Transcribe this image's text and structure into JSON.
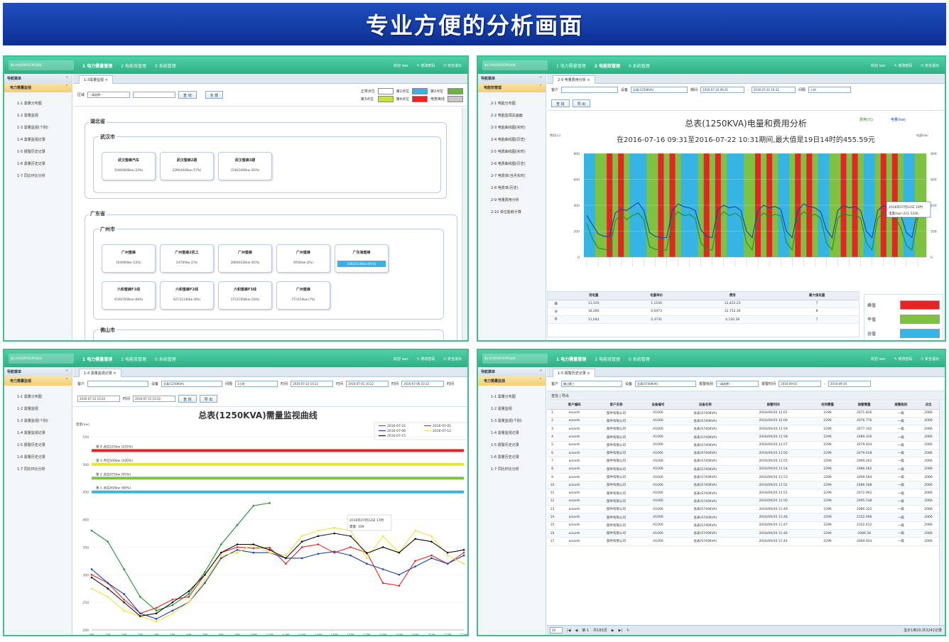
{
  "banner": {
    "title": "专业方便的分析画面"
  },
  "panel1": {
    "logo": "新川中创SKM2EMS系统",
    "menu_tabs": [
      "1 电力需量管理",
      "2 电能效管理",
      "0 系统管理"
    ],
    "user": "欢迎 iser",
    "change_pwd": "修改密码",
    "logout": "安全退出",
    "nav_title": "导航菜单",
    "group": "电力需量监视",
    "items": [
      "1-1 需量分布图",
      "1-2 需量监视",
      "1-3 需量监视(个别)",
      "1-4 需量监视记录",
      "1-5 报警历史记录",
      "1-6 需量历史记录",
      "1-7 同比环比分析"
    ],
    "tab": "1-3需量监视",
    "filter_label": "区域",
    "filter_select": "--请选择--",
    "query": "查 询",
    "all": "全 部",
    "legend": [
      "正常点位",
      "第1点位",
      "第2点位",
      "第3点位",
      "第4点位",
      "电表离线"
    ],
    "province1": "湖北省",
    "city1": "武汉市",
    "cards1": [
      {
        "n": "武汉蜜蜂汽车",
        "v": "1546/6600kw (24%)"
      },
      {
        "n": "武汉蜜蜂2期",
        "v": "2296/4000kw (57%)"
      },
      {
        "n": "武汉蜜蜂3期",
        "v": "1546/2400kw (65%)"
      }
    ],
    "province2": "广东省",
    "city2": "广州市",
    "cards2": [
      {
        "n": "广州蜜蜂",
        "v": "104/900kw (12%)"
      },
      {
        "n": "广州蜜蜂2机工",
        "v": "10/700kw (1%)"
      },
      {
        "n": "广州蜜蜂",
        "v": "2809/4320kw (65%)"
      },
      {
        "n": "广州蜜蜂",
        "v": "9/500kw (2%)"
      },
      {
        "n": "广东海蜜蜂",
        "v": "1042/1140kw (91%)"
      },
      {
        "n": "六和蜜蜂F1线",
        "v": "4740/7000kw (68%)"
      },
      {
        "n": "六和蜜蜂F2线",
        "v": "927/11140kw (8%)"
      },
      {
        "n": "六和蜜蜂F3线",
        "v": "1713/7000kw (24%)"
      },
      {
        "n": "广州蜜蜂",
        "v": "77/1150kw (7%)"
      }
    ],
    "city3": "佛山市"
  },
  "panel2": {
    "logo": "新川中创SKM2EMS系统",
    "menu_tabs": [
      "1 电力需量管理",
      "2 电能效管理",
      "0 系统管理"
    ],
    "user": "欢迎 iser",
    "change_pwd": "修改密码",
    "logout": "安全退出",
    "nav_title": "导航菜单",
    "group": "电能效管理",
    "items": [
      "2-1 电能分布图",
      "2-2 电能监视总画面",
      "2-3 电能曲线图(实时)",
      "2-4 电能曲线图(历史)",
      "2-5 电费曲线图(实时)",
      "2-6 电费曲线图(历史)",
      "2-7 电费单(当月实时)",
      "2-8 电费单(历史)",
      "2-9 电量费用分析",
      "2-10 单位能耗计算"
    ],
    "tab": "2-9 电量费用分析",
    "f_customer": "客户",
    "f_device": "设备",
    "f_device_val": "总表(1250KVA)",
    "f_period": "期间",
    "f_from": "2016-07-16 09:31",
    "f_to": "2016-07-22 10:31",
    "f_interval": "间隔",
    "f_interval_val": "小时",
    "query": "查 找",
    "export": "导 出",
    "chart_title": "总表(1250KVA)电量和费用分析",
    "subtitle": "在2016-07-16 09:31至2016-07-22 10:31期间,最大值是19日14时的455.59元",
    "legend_cost": "费用(元)",
    "legend_kwh": "电量(kw)",
    "yl_left": "费用(元)",
    "yl_right": "电量(kw)",
    "tooltip": [
      "2016年07月22日 10时",
      "电量(kw):221.5336"
    ],
    "table_headers": [
      "",
      "用电量",
      "电量单价",
      "费用",
      "最大值电量"
    ],
    "table_rows": [
      [
        "峰",
        "11,103",
        "1.1100",
        "12,422.23",
        "7"
      ],
      [
        "谷",
        "18,280",
        "0.6973",
        "12,752.36",
        "8"
      ],
      [
        "平",
        "11,044",
        "0.3731",
        "4,120.36",
        "7"
      ]
    ],
    "legend_rows": [
      "峰值",
      "平值",
      "谷值"
    ]
  },
  "panel3": {
    "logo": "新川中创SKM2EMS系统",
    "menu_tabs": [
      "1 电力需量管理",
      "2 电能效管理",
      "0 系统管理"
    ],
    "user": "欢迎 iser",
    "change_pwd": "修改密码",
    "logout": "安全退出",
    "nav_title": "导航菜单",
    "group": "电力需量监视",
    "items": [
      "1-1 需量分布图",
      "1-2 需量监视",
      "1-3 需量监视(个别)",
      "1-4 需量监视记录",
      "1-5 报警历史记录",
      "1-6 需量历史记录",
      "1-7 同比环比分析"
    ],
    "tab": "1-4 需量监视记录",
    "f_customer": "客户",
    "f_device": "设备",
    "f_device_val": "总表(1250KVA)",
    "f_interval": "间隔",
    "f_interval_val": "1小时",
    "f_time": "时间",
    "f_t1": "2016-07-22 10:22",
    "f_t2": "2016-07-01 10:22",
    "f_t3": "2016-07-06 10:22",
    "f_t4": "2016-07-12 10:22",
    "f_t5": "2016-07-15 10:22",
    "query": "查 找",
    "export": "导 出",
    "chart_title": "总表(1250KVA)需量监视曲线",
    "ylabel": "需量(kw)",
    "series_names": [
      "2016-07-22",
      "2016-07-01",
      "2016-07-06",
      "2016-07-12",
      "2016-07-15"
    ],
    "limits": [
      "第 4 点位525kw (105%)",
      "第 3 点位500kw (100%)",
      "第 2 点位475kw (95%)",
      "第 1 点位450kw (90%)"
    ],
    "tooltip": [
      "2016年07月12日 17时",
      "需量: 339"
    ]
  },
  "panel4": {
    "logo": "新川中创SKM2EMS系统",
    "menu_tabs": [
      "1 电力需量管理",
      "2 电能效管理",
      "0 系统管理"
    ],
    "user": "欢迎 iser",
    "change_pwd": "修改密码",
    "logout": "安全退出",
    "nav_title": "导航菜单",
    "group": "电力需量监视",
    "items": [
      "1-1 需量分布图",
      "1-2 需量监视",
      "1-3 需量监视(个别)",
      "1-4 需量监视记录",
      "1-5 报警历史记录",
      "1-6 需量历史记录",
      "1-7 同比环比分析"
    ],
    "tab": "1-5 报警历史记录",
    "f_customer": "客户",
    "f_customer_val": "佛山蜜三",
    "f_device": "设备",
    "f_device_val": "总表(S740KVA)",
    "f_level": "报警级别",
    "f_level_val": "--请选择--",
    "f_time": "报警时间",
    "f_from": "2016-09-01",
    "f_to": "2016-09-30",
    "query": "查找",
    "export": "导出",
    "headers": [
      "",
      "客户编码",
      "客户名称",
      "设备编号",
      "设备名称",
      "报警时间",
      "合同需量",
      "报警需量",
      "报警级别",
      "点位"
    ],
    "rows": [
      [
        "1",
        "aisanfs",
        "部件有限公司",
        "A1000",
        "总表(S740KVA)",
        "2016/09/20 12:01",
        "2296",
        "2071.816",
        "一级",
        "2066"
      ],
      [
        "2",
        "aisanfs",
        "部件有限公司",
        "A1000",
        "总表(S740KVA)",
        "2016/09/20 12:00",
        "2296",
        "2076.776",
        "一级",
        "2066"
      ],
      [
        "3",
        "aisanfs",
        "部件有限公司",
        "A1000",
        "总表(S740KVA)",
        "2016/09/20 11:59",
        "2296",
        "2077.102",
        "一级",
        "2066"
      ],
      [
        "4",
        "aisanfs",
        "部件有限公司",
        "A1000",
        "总表(S740KVA)",
        "2016/09/20 11:58",
        "2296",
        "2089.316",
        "一级",
        "2066"
      ],
      [
        "5",
        "aisanfs",
        "部件有限公司",
        "A1000",
        "总表(S740KVA)",
        "2016/09/20 11:57",
        "2296",
        "2079.024",
        "一级",
        "2066"
      ],
      [
        "6",
        "aisanfs",
        "部件有限公司",
        "A1000",
        "总表(S740KVA)",
        "2016/09/20 11:56",
        "2296",
        "2079.018",
        "一级",
        "2066"
      ],
      [
        "7",
        "aisanfs",
        "部件有限公司",
        "A1000",
        "总表(S740KVA)",
        "2016/09/20 11:55",
        "2296",
        "2069.202",
        "一级",
        "2066"
      ],
      [
        "8",
        "aisanfs",
        "部件有限公司",
        "A1000",
        "总表(S740KVA)",
        "2016/09/20 11:54",
        "2296",
        "2086.562",
        "一级",
        "2066"
      ],
      [
        "9",
        "aisanfs",
        "部件有限公司",
        "A1000",
        "总表(S740KVA)",
        "2016/09/20 11:53",
        "2296",
        "2069.564",
        "一级",
        "2066"
      ],
      [
        "10",
        "aisanfs",
        "部件有限公司",
        "A1000",
        "总表(S740KVA)",
        "2016/09/20 11:52",
        "2296",
        "2086.568",
        "一级",
        "2066"
      ],
      [
        "11",
        "aisanfs",
        "部件有限公司",
        "A1000",
        "总表(S740KVA)",
        "2016/09/20 11:51",
        "2296",
        "2072.902",
        "一级",
        "2066"
      ],
      [
        "12",
        "aisanfs",
        "部件有限公司",
        "A1000",
        "总表(S740KVA)",
        "2016/09/20 11:50",
        "2296",
        "2095.538",
        "一级",
        "2066"
      ],
      [
        "13",
        "aisanfs",
        "部件有限公司",
        "A1000",
        "总表(S740KVA)",
        "2016/09/20 11:49",
        "2296",
        "2080.322",
        "一级",
        "2066"
      ],
      [
        "14",
        "aisanfs",
        "部件有限公司",
        "A1000",
        "总表(S740KVA)",
        "2016/09/20 11:48",
        "2296",
        "2102.006",
        "一级",
        "2066"
      ],
      [
        "15",
        "aisanfs",
        "部件有限公司",
        "A1000",
        "总表(S740KVA)",
        "2016/09/20 11:47",
        "2296",
        "2102.412",
        "一级",
        "2066"
      ],
      [
        "16",
        "aisanfs",
        "部件有限公司",
        "A1000",
        "总表(S740KVA)",
        "2016/09/20 11:46",
        "2296",
        "2086.58",
        "一级",
        "2066"
      ],
      [
        "17",
        "aisanfs",
        "部件有限公司",
        "A1000",
        "总表(S740KVA)",
        "2016/09/20 11:44",
        "2296",
        "2069.924",
        "一级",
        "2066"
      ]
    ],
    "pager_size": "20",
    "pager_page": "第 1",
    "pager_total": "共183页",
    "pager_info": "显示1到20,共3242记录"
  },
  "chart_data": [
    {
      "type": "bar+line",
      "title": "总表(1250KVA)电量和费用分析",
      "ylim": [
        0,
        800
      ],
      "yticks": [
        0,
        200,
        400,
        600,
        800
      ],
      "band_colors": {
        "peak": "#e52525",
        "flat": "#7fc241",
        "valley": "#36b5e5"
      },
      "bands": [
        "v",
        "v",
        "f",
        "f",
        "p",
        "f",
        "p",
        "f",
        "v",
        "v",
        "v",
        "f",
        "f",
        "p",
        "f",
        "p",
        "f",
        "v",
        "v",
        "v",
        "f",
        "p",
        "f",
        "p",
        "f",
        "v",
        "v",
        "v",
        "f",
        "f",
        "p",
        "f",
        "p",
        "f",
        "v",
        "v",
        "f",
        "p",
        "f",
        "p",
        "f",
        "v",
        "v",
        "f",
        "f",
        "p",
        "f",
        "p",
        "f",
        "v",
        "v",
        "f",
        "p",
        "f",
        "p",
        "f",
        "v",
        "v",
        "f",
        "f"
      ],
      "series": [
        {
          "name": "费用(元)",
          "color": "#1e8f2a",
          "values": [
            260,
            140,
            70,
            60,
            55,
            280,
            330,
            290,
            320,
            340,
            290,
            80,
            60,
            55,
            55,
            300,
            350,
            320,
            330,
            300,
            110,
            60,
            55,
            300,
            350,
            320,
            340,
            310,
            110,
            55,
            300,
            340,
            310,
            330,
            320,
            110,
            55,
            300,
            350,
            320,
            330,
            300,
            110,
            55,
            300,
            340,
            320,
            330,
            300,
            110,
            55,
            300,
            340,
            320,
            310,
            230,
            90,
            55,
            300,
            340
          ]
        },
        {
          "name": "电量(kw)",
          "color": "#1a3fa8",
          "values": [
            320,
            250,
            180,
            160,
            160,
            340,
            370,
            360,
            390,
            420,
            360,
            190,
            160,
            150,
            150,
            360,
            410,
            390,
            380,
            360,
            210,
            160,
            150,
            370,
            400,
            380,
            390,
            360,
            200,
            150,
            360,
            400,
            380,
            390,
            370,
            200,
            150,
            360,
            410,
            390,
            380,
            350,
            210,
            150,
            360,
            400,
            380,
            390,
            360,
            200,
            150,
            360,
            400,
            380,
            370,
            330,
            190,
            150,
            360,
            400
          ]
        }
      ]
    },
    {
      "type": "line",
      "title": "总表(1250KVA)需量监视曲线",
      "ylabel": "需量(kw)",
      "ylim": [
        200,
        550
      ],
      "yticks": [
        200,
        250,
        300,
        350,
        400,
        450,
        500,
        550
      ],
      "x": [
        "0时",
        "1时",
        "2时",
        "3时",
        "4时",
        "5时",
        "6时",
        "7时",
        "8时",
        "9时",
        "10时",
        "11时",
        "12时",
        "13时",
        "14时",
        "15时",
        "16时",
        "17时",
        "18时",
        "19时",
        "20时",
        "21时",
        "22时",
        "23时"
      ],
      "thresholds": [
        {
          "name": "第 4 点位525kw (105%)",
          "value": 525,
          "color": "#e52525"
        },
        {
          "name": "第 3 点位500kw (100%)",
          "value": 500,
          "color": "#e6e63a"
        },
        {
          "name": "第 2 点位475kw (95%)",
          "value": 475,
          "color": "#7fc241"
        },
        {
          "name": "第 1 点位450kw (90%)",
          "value": 450,
          "color": "#36b5e5"
        }
      ],
      "series": [
        {
          "name": "2016-07-22",
          "color": "#1e8f2a",
          "values": [
            380,
            360,
            310,
            260,
            235,
            245,
            265,
            305,
            355,
            390,
            425,
            430,
            null,
            null,
            null,
            null,
            null,
            null,
            null,
            null,
            null,
            null,
            null,
            null
          ]
        },
        {
          "name": "2016-07-01",
          "color": "#e52525",
          "values": [
            300,
            285,
            255,
            230,
            240,
            255,
            260,
            300,
            340,
            350,
            348,
            349,
            320,
            350,
            355,
            340,
            350,
            340,
            285,
            280,
            325,
            335,
            320,
            340
          ]
        },
        {
          "name": "2016-07-06",
          "color": "#1a3fa8",
          "values": [
            310,
            285,
            265,
            230,
            220,
            235,
            250,
            285,
            330,
            345,
            340,
            340,
            330,
            330,
            338,
            342,
            335,
            320,
            310,
            300,
            315,
            330,
            320,
            335
          ]
        },
        {
          "name": "2016-07-12",
          "color": "#f0e040",
          "values": [
            275,
            260,
            235,
            225,
            215,
            230,
            250,
            290,
            335,
            340,
            355,
            340,
            335,
            370,
            380,
            385,
            380,
            330,
            370,
            340,
            380,
            370,
            335,
            320
          ]
        },
        {
          "name": "2016-07-15",
          "color": "#111",
          "values": [
            295,
            275,
            250,
            225,
            230,
            250,
            270,
            300,
            340,
            355,
            355,
            345,
            330,
            360,
            370,
            375,
            370,
            339,
            350,
            340,
            365,
            360,
            340,
            345
          ]
        }
      ]
    }
  ]
}
